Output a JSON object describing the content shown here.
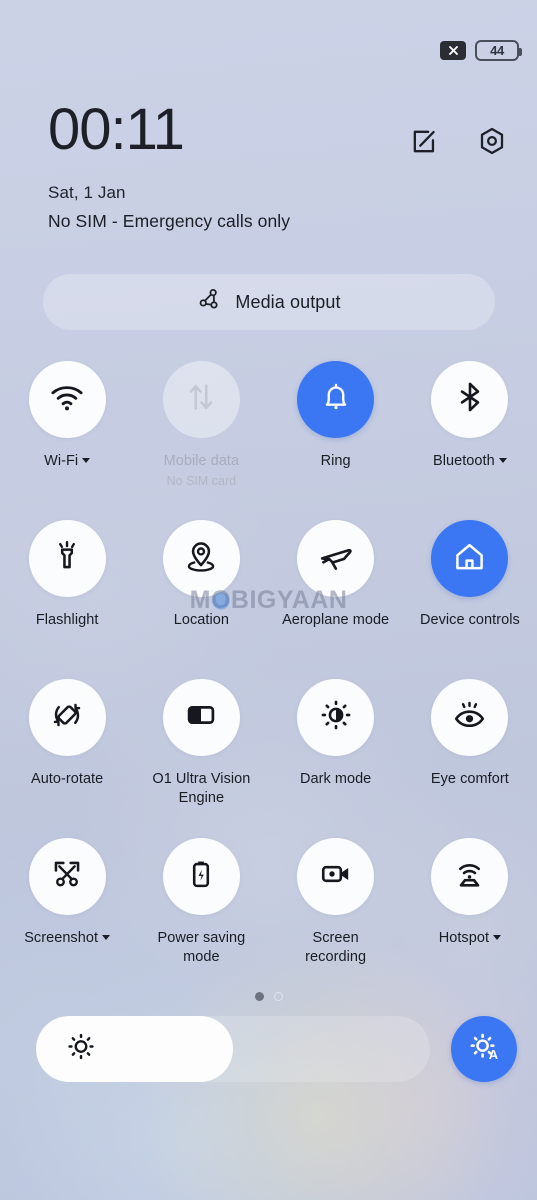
{
  "statusbar": {
    "signal_badge_icon": "no-signal-x-icon",
    "battery_level": "44",
    "battery_icon": "battery-icon"
  },
  "header": {
    "time": "00:11",
    "date": "Sat, 1 Jan",
    "sim_status": "No SIM - Emergency calls only",
    "edit_icon": "edit-pencil-square-icon",
    "settings_icon": "hexagon-settings-icon"
  },
  "media_output": {
    "label": "Media output",
    "icon": "media-cast-share-icon"
  },
  "watermark": {
    "prefix": "M",
    "o": "O",
    "suffix": "BIGYAAN"
  },
  "colors": {
    "accent_blue": "#3b76f3",
    "tile_white": "#fbfcfd",
    "background": "#c2cadf",
    "text_primary": "#1a1d24",
    "text_muted": "#a9aebd"
  },
  "tiles": [
    [
      {
        "label": "Wi-Fi",
        "icon": "wifi-icon",
        "state": "on",
        "caret": true
      },
      {
        "label": "Mobile data",
        "sublabel": "No SIM card",
        "icon": "mobile-data-arrows-icon",
        "state": "disabled",
        "caret": false
      },
      {
        "label": "Ring",
        "icon": "bell-ring-icon",
        "state": "active",
        "caret": false
      },
      {
        "label": "Bluetooth",
        "icon": "bluetooth-icon",
        "state": "on",
        "caret": true
      }
    ],
    [
      {
        "label": "Flashlight",
        "icon": "flashlight-icon",
        "state": "on",
        "caret": false
      },
      {
        "label": "Location",
        "icon": "location-pin-icon",
        "state": "on",
        "caret": false
      },
      {
        "label": "Aeroplane mode",
        "icon": "aeroplane-icon",
        "state": "on",
        "caret": false
      },
      {
        "label": "Device controls",
        "icon": "home-house-icon",
        "state": "active",
        "caret": false
      }
    ],
    [
      {
        "label": "Auto-rotate",
        "icon": "auto-rotate-icon",
        "state": "on",
        "caret": false
      },
      {
        "label": "O1 Ultra Vision Engine",
        "icon": "split-screen-contrast-icon",
        "state": "on",
        "caret": false
      },
      {
        "label": "Dark mode",
        "icon": "dark-mode-sun-icon",
        "state": "on",
        "caret": false
      },
      {
        "label": "Eye comfort",
        "icon": "eye-comfort-icon",
        "state": "on",
        "caret": false
      }
    ],
    [
      {
        "label": "Screenshot",
        "icon": "screenshot-scissors-icon",
        "state": "on",
        "caret": true
      },
      {
        "label": "Power saving mode",
        "icon": "battery-bolt-icon",
        "state": "on",
        "caret": false
      },
      {
        "label": "Screen recording",
        "icon": "video-record-icon",
        "state": "on",
        "caret": false
      },
      {
        "label": "Hotspot",
        "icon": "hotspot-router-icon",
        "state": "on",
        "caret": true
      }
    ]
  ],
  "pager": {
    "total": 2,
    "active_index": 0
  },
  "brightness": {
    "value_percent": 50,
    "slider_icon": "brightness-sun-icon",
    "auto_button_icon": "auto-brightness-sun-a-icon",
    "auto_label": "A"
  }
}
